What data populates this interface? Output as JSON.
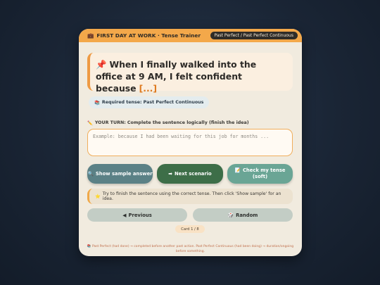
{
  "header": {
    "title": "FIRST DAY AT WORK · Tense Trainer",
    "briefcase_icon": "💼",
    "tense_badge": "Past Perfect / Past Perfect Continuous"
  },
  "scenario": {
    "pin_icon": "📌",
    "text": "When I finally walked into the office at 9 AM, I felt confident because",
    "blank": "[...]"
  },
  "required_tense": {
    "icon": "📚",
    "label": "Required tense: Past Perfect Continuous"
  },
  "your_turn": {
    "icon": "✏️",
    "label": "YOUR TURN: Complete the sentence logically (finish the idea)"
  },
  "answer": {
    "value": "",
    "placeholder": "Example: because I had been waiting for this job for months ..."
  },
  "actions": {
    "show_sample": {
      "icon": "🔍",
      "label": "Show sample answer"
    },
    "next_scenario": {
      "icon": "➡",
      "label": "Next scenario"
    },
    "check_tense": {
      "icon": "📝",
      "label": "Check my tense (soft)"
    }
  },
  "hint": {
    "icon": "⭐",
    "text": "Try to finish the sentence using the correct tense. Then click 'Show sample' for an idea."
  },
  "navigation": {
    "previous": {
      "icon": "◀",
      "label": "Previous"
    },
    "random": {
      "icon": "🎲",
      "label": "Random"
    }
  },
  "card_counter": "Card 1 / 8",
  "footer_note": "📚 Past Perfect (had done) → completed before another past action. Past Perfect Continuous (had been doing) → duration/ongoing before something.",
  "colors": {
    "header_bg": "#f3a84a",
    "accent_orange": "#ee9a44",
    "teal_button": "#5b8186",
    "green_button": "#3d6e48",
    "mint_button": "#6aa595"
  }
}
